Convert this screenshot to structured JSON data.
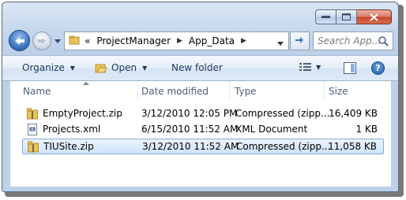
{
  "nav": {
    "breadcrumb": [
      "ProjectManager",
      "App_Data"
    ],
    "overflow_glyph": "«",
    "search_placeholder": "Search App..."
  },
  "toolbar": {
    "organize_label": "Organize",
    "open_label": "Open",
    "new_folder_label": "New folder"
  },
  "columns": {
    "name": "Name",
    "date": "Date modified",
    "type": "Type",
    "size": "Size"
  },
  "files": [
    {
      "name": "EmptyProject.zip",
      "date": "3/12/2010 12:05 PM",
      "type": "Compressed (zipp...",
      "size": "16,409 KB",
      "icon": "zip-folder-icon",
      "selected": false
    },
    {
      "name": "Projects.xml",
      "date": "6/15/2010 11:52 AM",
      "type": "XML Document",
      "size": "1 KB",
      "icon": "xml-document-icon",
      "selected": false
    },
    {
      "name": "TIUSite.zip",
      "date": "3/12/2010 11:52 AM",
      "type": "Compressed (zipp...",
      "size": "11,058 KB",
      "icon": "zip-folder-icon",
      "selected": true
    }
  ],
  "colors": {
    "selection": "#cfe4fb",
    "selection_border": "#84acdd",
    "header_text": "#4c607a",
    "close_button": "#c8432c"
  }
}
